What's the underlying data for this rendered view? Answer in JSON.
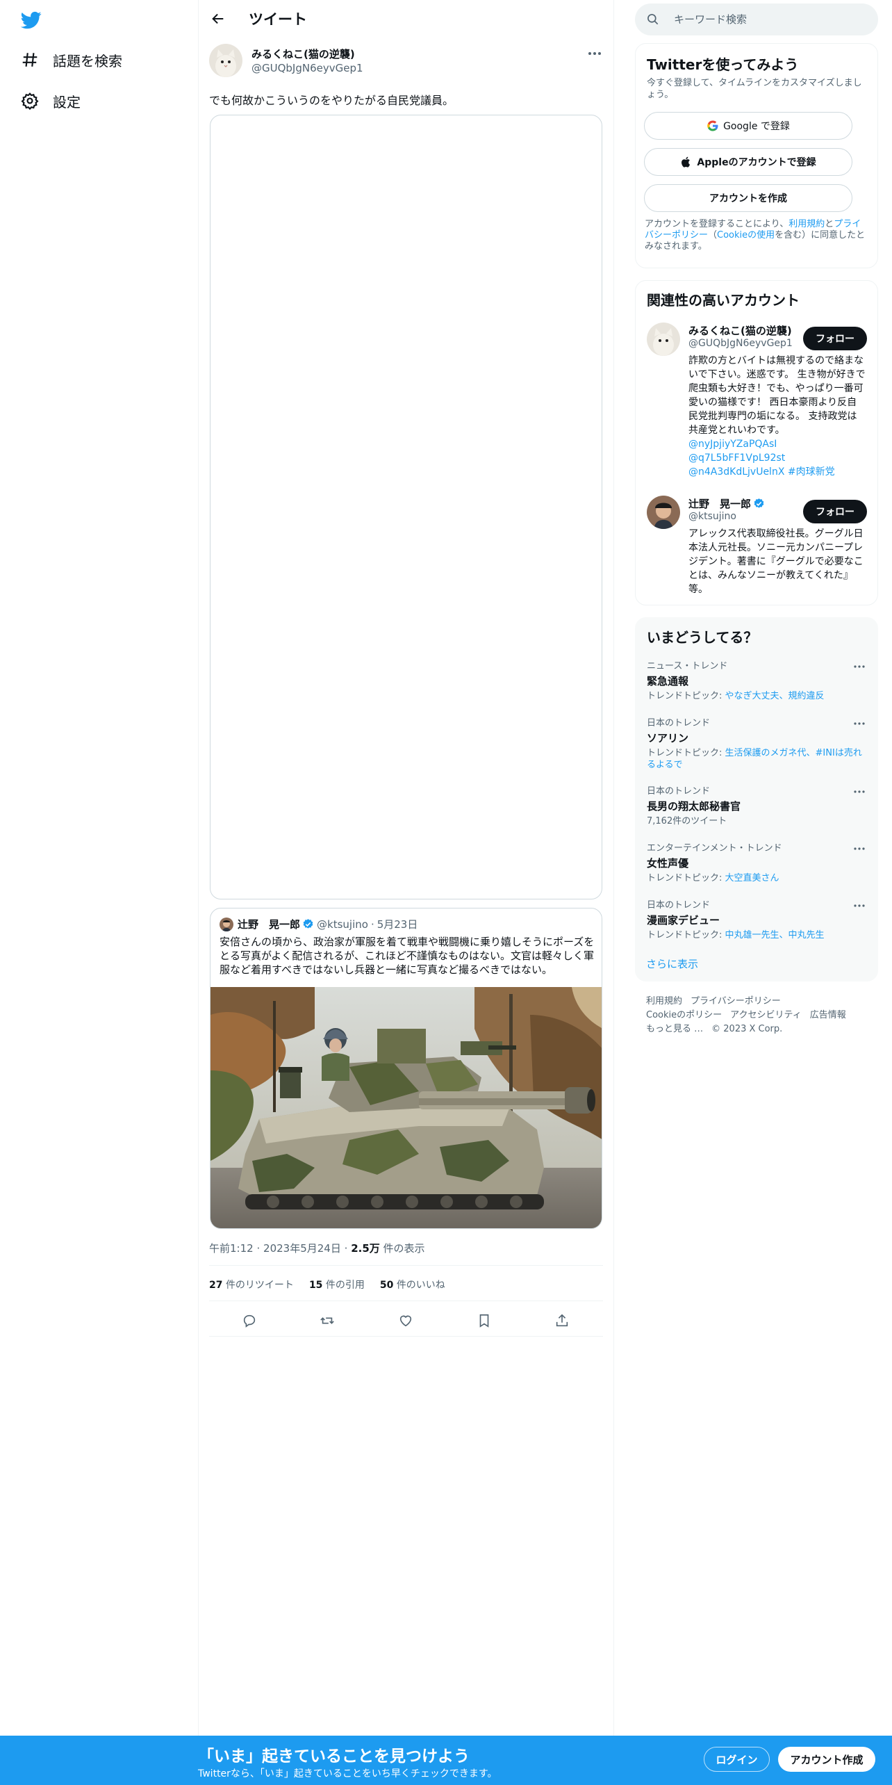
{
  "nav": {
    "logo_icon": "twitter-bird-icon",
    "items": [
      {
        "label": "話題を検索",
        "icon": "hashtag-icon"
      },
      {
        "label": "設定",
        "icon": "gear-icon"
      }
    ]
  },
  "header": {
    "title": "ツイート",
    "back_icon": "arrow-left-icon"
  },
  "tweet": {
    "name": "みるくねこ(猫の逆襲)",
    "handle": "@GUQbJgN6eyvGep1",
    "text": "でも何故かこういうのをやりたがる自民党議員。",
    "quote": {
      "name": "辻野　晃一郎",
      "handle": "@ktsujino",
      "dot": "·",
      "date": "5月23日",
      "text": "安倍さんの頃から、政治家が軍服を着て戦車や戦闘機に乗り嬉しそうにポーズをとる写真がよく配信されるが、これほど不謹慎なものはない。文官は軽々しく軍服など着用すべきではないし兵器と一緒に写真など撮るべきではない。"
    },
    "meta": {
      "time": "午前1:12",
      "sep1": "·",
      "date": "2023年5月24日",
      "sep2": "·",
      "views": "2.5万",
      "views_label": "件の表示"
    },
    "stats": {
      "retweets": "27",
      "retweets_label": "件のリツイート",
      "quotes": "15",
      "quotes_label": "件の引用",
      "likes": "50",
      "likes_label": "件のいいね"
    }
  },
  "search": {
    "placeholder": "キーワード検索"
  },
  "signup": {
    "title": "Twitterを使ってみよう",
    "subtitle": "今すぐ登録して、タイムラインをカスタマイズしましょう。",
    "google_label": "Google で登録",
    "apple_label": "Appleのアカウントで登録",
    "create_label": "アカウントを作成",
    "terms_prefix": "アカウントを登録することにより、",
    "terms_link": "利用規約",
    "terms_and": "と",
    "privacy_link": "プライバシーポリシー",
    "terms_paren_open": "（",
    "cookie_link": "Cookieの使用",
    "terms_suffix": "を含む）に同意したとみなされます。"
  },
  "related": {
    "title": "関連性の高いアカウント",
    "accounts": [
      {
        "name": "みるくねこ(猫の逆襲)",
        "handle": "@GUQbJgN6eyvGep1",
        "follow": "フォロー",
        "bio": "詐欺の方とバイトは無視するので絡まないで下さい。迷惑です。 生き物が好きで爬虫類も大好き！でも、やっぱり一番可愛いの猫様です！ 西日本豪雨より反自民党批判専門の垢になる。 支持政党は共産党とれいわです。",
        "links": [
          "@nyJpjiyYZaPQAsI",
          "@q7L5bFF1VpL92st",
          "@n4A3dKdLjvUelnX #肉球新党"
        ]
      },
      {
        "name": "辻野　晃一郎",
        "handle": "@ktsujino",
        "follow": "フォロー",
        "bio": "アレックス代表取締役社長。グーグル日本法人元社長。ソニー元カンパニープレジデント。著書に『グーグルで必要なことは、みんなソニーが教えてくれた』等。"
      }
    ]
  },
  "trends": {
    "title": "いまどうしてる？",
    "topic_prefix": "トレンドトピック:",
    "items": [
      {
        "category": "ニュース・トレンド",
        "title": "緊急通報",
        "topics": "やなぎ大丈夫、規約違反"
      },
      {
        "category": "日本のトレンド",
        "title": "ソアリン",
        "topics": "生活保護のメガネ代、#INIは売れるよるで"
      },
      {
        "category": "日本のトレンド",
        "title": "長男の翔太郎秘書官",
        "count": "7,162件のツイート"
      },
      {
        "category": "エンターテインメント・トレンド",
        "title": "女性声優",
        "topics": "大空直美さん"
      },
      {
        "category": "日本のトレンド",
        "title": "漫画家デビュー",
        "topics": "中丸雄一先生、中丸先生"
      }
    ],
    "show_more": "さらに表示"
  },
  "footer": {
    "links": [
      "利用規約",
      "プライバシーポリシー",
      "Cookieのポリシー",
      "アクセシビリティ",
      "広告情報",
      "もっと見る …",
      "© 2023 X Corp."
    ]
  },
  "bottom_bar": {
    "title": "「いま」起きていることを見つけよう",
    "subtitle": "Twitterなら、「いま」起きていることをいち早くチェックできます。",
    "login": "ログイン",
    "signup": "アカウント作成"
  },
  "colors": {
    "accent": "#1d9bf0",
    "text": "#0f1419",
    "muted": "#536471",
    "border": "#eff3f4"
  }
}
